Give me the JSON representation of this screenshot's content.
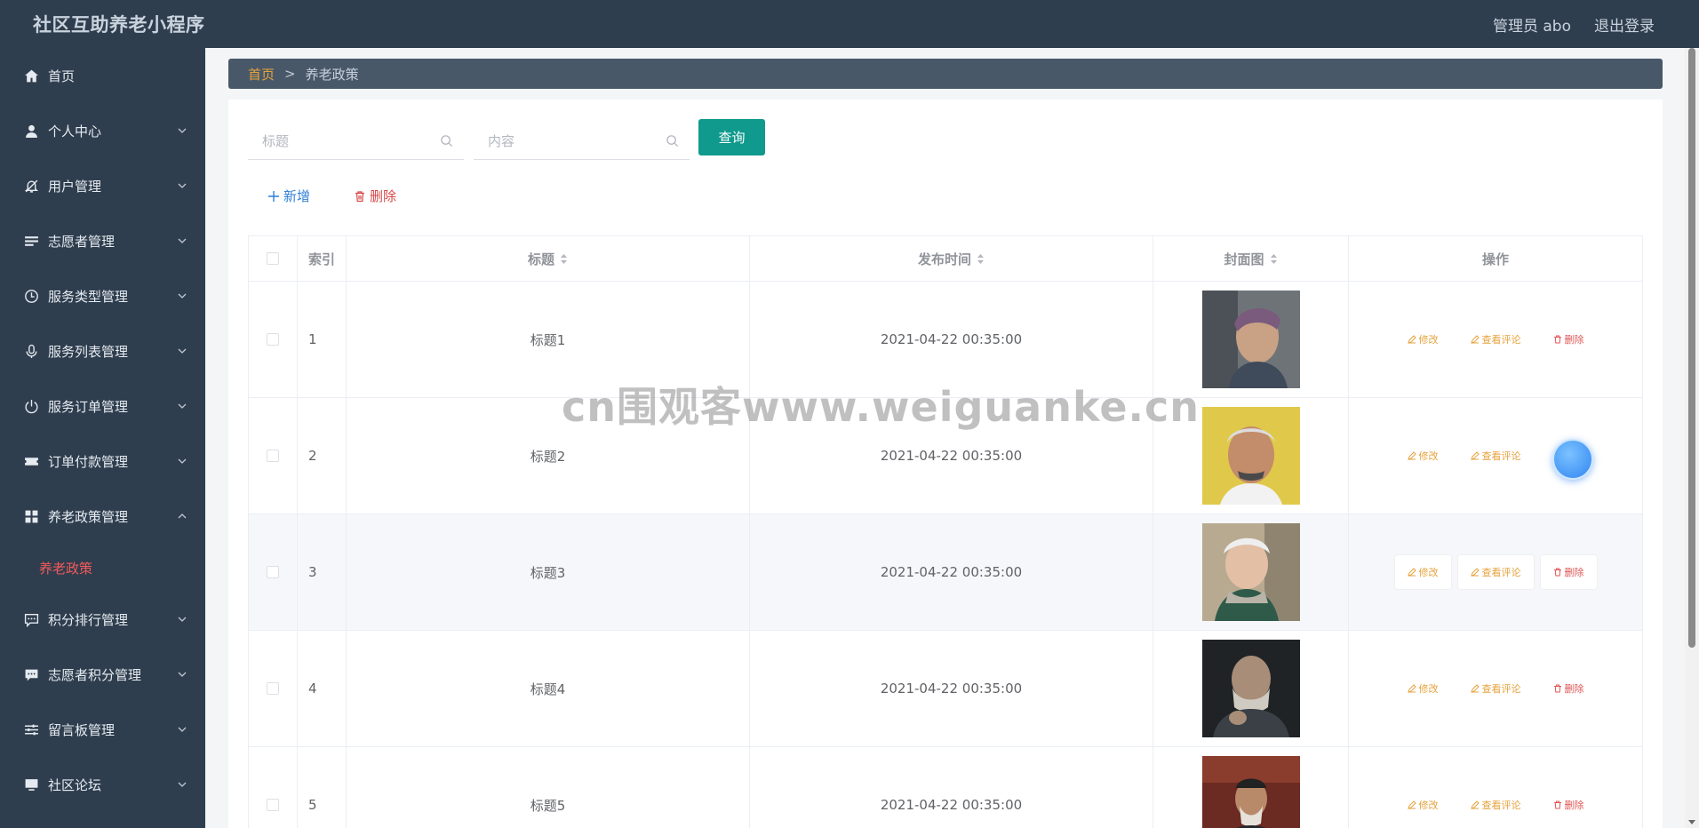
{
  "app": {
    "title": "社区互助养老小程序"
  },
  "header": {
    "user": "管理员 abo",
    "logout": "退出登录"
  },
  "sidebar": {
    "items": [
      {
        "label": "首页",
        "icon": "home-icon"
      },
      {
        "label": "个人中心",
        "icon": "user-icon"
      },
      {
        "label": "用户管理",
        "icon": "bell-off-icon"
      },
      {
        "label": "志愿者管理",
        "icon": "list-icon"
      },
      {
        "label": "服务类型管理",
        "icon": "clock-icon"
      },
      {
        "label": "服务列表管理",
        "icon": "microphone-icon"
      },
      {
        "label": "服务订单管理",
        "icon": "power-icon"
      },
      {
        "label": "订单付款管理",
        "icon": "ticket-icon"
      },
      {
        "label": "养老政策管理",
        "icon": "grid-icon"
      },
      {
        "label": "积分排行管理",
        "icon": "chat-icon"
      },
      {
        "label": "志愿者积分管理",
        "icon": "message-icon"
      },
      {
        "label": "留言板管理",
        "icon": "sliders-icon"
      },
      {
        "label": "社区论坛",
        "icon": "monitor-icon"
      }
    ],
    "active_sub": "养老政策"
  },
  "breadcrumb": {
    "home": "首页",
    "sep": ">",
    "current": "养老政策"
  },
  "search": {
    "title_placeholder": "标题",
    "content_placeholder": "内容",
    "query_label": "查询"
  },
  "actions": {
    "add_label": "新增",
    "delete_label": "删除"
  },
  "table": {
    "columns": [
      "索引",
      "标题",
      "发布时间",
      "封面图",
      "操作"
    ],
    "ops": {
      "edit": "修改",
      "view": "查看评论",
      "remove": "删除"
    },
    "rows": [
      {
        "index": "1",
        "title": "标题1",
        "time": "2021-04-22 00:35:00"
      },
      {
        "index": "2",
        "title": "标题2",
        "time": "2021-04-22 00:35:00"
      },
      {
        "index": "3",
        "title": "标题3",
        "time": "2021-04-22 00:35:00"
      },
      {
        "index": "4",
        "title": "标题4",
        "time": "2021-04-22 00:35:00"
      },
      {
        "index": "5",
        "title": "标题5",
        "time": "2021-04-22 00:35:00"
      }
    ]
  },
  "watermark": "cn围观客www.weiguanke.cn",
  "colors": {
    "topbar": "#2f3e4e",
    "accent": "#0f9a8d",
    "active": "#f05a5a"
  }
}
